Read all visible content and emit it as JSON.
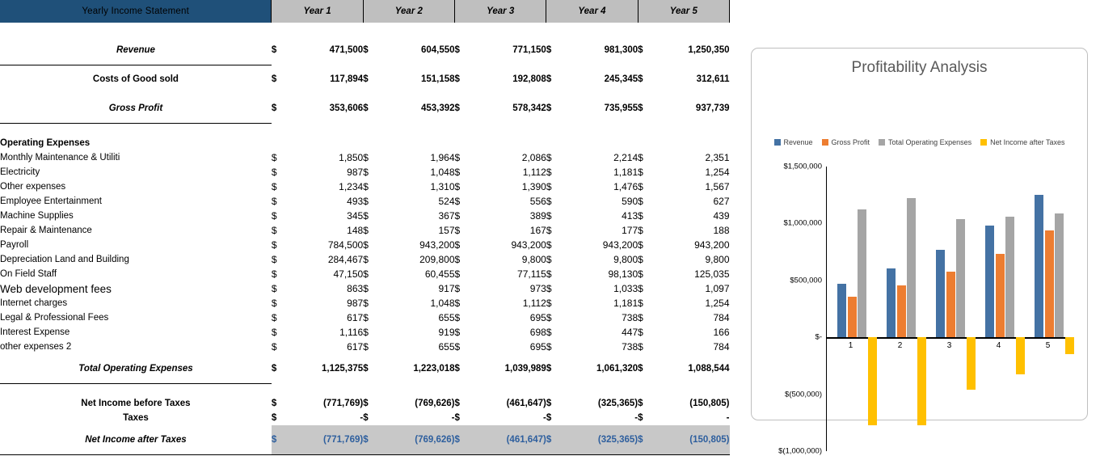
{
  "header": {
    "title": "Yearly Income Statement",
    "years": [
      "Year 1",
      "Year 2",
      "Year 3",
      "Year 4",
      "Year 5"
    ]
  },
  "currency_symbol": "$",
  "rows": {
    "revenue": {
      "label": "Revenue",
      "values": [
        "471,500",
        "604,550",
        "771,150",
        "981,300",
        "1,250,350"
      ]
    },
    "cogs": {
      "label": "Costs of Good sold",
      "values": [
        "117,894",
        "151,158",
        "192,808",
        "245,345",
        "312,611"
      ]
    },
    "gross_profit": {
      "label": "Gross Profit",
      "values": [
        "353,606",
        "453,392",
        "578,342",
        "735,955",
        "937,739"
      ]
    },
    "opex_header": {
      "label": "Operating Expenses"
    },
    "total_opex": {
      "label": "Total Operating Expenses",
      "values": [
        "1,125,375",
        "1,223,018",
        "1,039,989",
        "1,061,320",
        "1,088,544"
      ]
    },
    "nibt": {
      "label": "Net Income before Taxes",
      "values": [
        "(771,769)",
        "(769,626)",
        "(461,647)",
        "(325,365)",
        "(150,805)"
      ]
    },
    "taxes": {
      "label": "Taxes",
      "values": [
        "-",
        "-",
        "-",
        "-",
        "-"
      ]
    },
    "niat": {
      "label": "Net Income after Taxes",
      "values": [
        "(771,769)",
        "(769,626)",
        "(461,647)",
        "(325,365)",
        "(150,805)"
      ]
    }
  },
  "operating_expenses": [
    {
      "label": "Monthly Maintenance & Utiliti",
      "values": [
        "1,850",
        "1,964",
        "2,086",
        "2,214",
        "2,351"
      ]
    },
    {
      "label": "Electricity",
      "values": [
        "987",
        "1,048",
        "1,112",
        "1,181",
        "1,254"
      ]
    },
    {
      "label": "Other expenses",
      "values": [
        "1,234",
        "1,310",
        "1,390",
        "1,476",
        "1,567"
      ]
    },
    {
      "label": "Employee Entertainment",
      "values": [
        "493",
        "524",
        "556",
        "590",
        "627"
      ]
    },
    {
      "label": "Machine Supplies",
      "values": [
        "345",
        "367",
        "389",
        "413",
        "439"
      ]
    },
    {
      "label": "Repair & Maintenance",
      "values": [
        "148",
        "157",
        "167",
        "177",
        "188"
      ]
    },
    {
      "label": "Payroll",
      "values": [
        "784,500",
        "943,200",
        "943,200",
        "943,200",
        "943,200"
      ]
    },
    {
      "label": "Depreciation Land and Building",
      "values": [
        "284,467",
        "209,800",
        "9,800",
        "9,800",
        "9,800"
      ]
    },
    {
      "label": "On Field Staff",
      "values": [
        "47,150",
        "60,455",
        "77,115",
        "98,130",
        "125,035"
      ]
    },
    {
      "label": "Web development fees",
      "values": [
        "863",
        "917",
        "973",
        "1,033",
        "1,097"
      ]
    },
    {
      "label": "Internet charges",
      "values": [
        "987",
        "1,048",
        "1,112",
        "1,181",
        "1,254"
      ]
    },
    {
      "label": "Legal & Professional Fees",
      "values": [
        "617",
        "655",
        "695",
        "738",
        "784"
      ]
    },
    {
      "label": "Interest Expense",
      "values": [
        "1,116",
        "919",
        "698",
        "447",
        "166"
      ]
    },
    {
      "label": "other expenses 2",
      "values": [
        "617",
        "655",
        "695",
        "738",
        "784"
      ]
    }
  ],
  "colors": {
    "header_bar": "#1F5079",
    "year_header_bg": "#BFBFBF",
    "accent_blue": "#2E5F9E",
    "series_revenue": "#4472A4",
    "series_gross_profit": "#ED7D31",
    "series_opex": "#A5A5A5",
    "series_net_income": "#FFC000",
    "net_row_bg": "#C8C8C8"
  },
  "chart_data": {
    "type": "bar",
    "title": "Profitability Analysis",
    "categories": [
      "1",
      "2",
      "3",
      "4",
      "5"
    ],
    "series": [
      {
        "name": "Revenue",
        "color": "#4472A4",
        "values": [
          471500,
          604550,
          771150,
          981300,
          1250350
        ]
      },
      {
        "name": "Gross Profit",
        "color": "#ED7D31",
        "values": [
          353606,
          453392,
          578342,
          735955,
          937739
        ]
      },
      {
        "name": "Total Operating Expenses",
        "color": "#A5A5A5",
        "values": [
          1125375,
          1223018,
          1039989,
          1061320,
          1088544
        ]
      },
      {
        "name": "Net Income after Taxes",
        "color": "#FFC000",
        "values": [
          -771769,
          -769626,
          -461647,
          -325365,
          -150805
        ]
      }
    ],
    "ylim": [
      -1000000,
      1500000
    ],
    "yticks": [
      1500000,
      1000000,
      500000,
      0,
      -500000,
      -1000000
    ],
    "ytick_labels": [
      "$1,500,000",
      "$1,000,000",
      "$500,000",
      "$-",
      "$(500,000)",
      "$(1,000,000)"
    ],
    "xlabel": "",
    "ylabel": "",
    "grid": false,
    "legend_position": "top"
  }
}
